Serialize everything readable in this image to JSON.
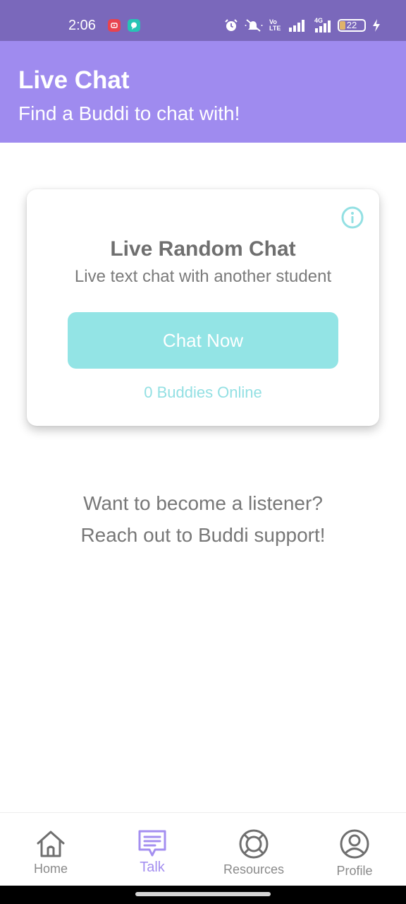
{
  "status_bar": {
    "time": "2:06",
    "network_label": "4G",
    "volte_label": "Vo LTE",
    "battery_level": "22",
    "icons": [
      "youtube-app-icon",
      "chat-app-icon",
      "alarm-icon",
      "mute-icon",
      "volte-icon",
      "signal-icon",
      "signal-4g-icon",
      "battery-icon",
      "charging-icon"
    ]
  },
  "header": {
    "title": "Live Chat",
    "subtitle": "Find a Buddi to chat with!"
  },
  "card": {
    "title": "Live Random Chat",
    "subtitle": "Live text chat with another student",
    "button_label": "Chat Now",
    "online_count_text": "0 Buddies Online",
    "info_icon": "info-icon"
  },
  "listener_promo": {
    "line1": "Want to become a listener?",
    "line2": "Reach out to Buddi support!"
  },
  "bottom_nav": {
    "items": [
      {
        "label": "Home",
        "icon": "home-icon",
        "active": false
      },
      {
        "label": "Talk",
        "icon": "chat-bubble-icon",
        "active": true
      },
      {
        "label": "Resources",
        "icon": "lifebuoy-icon",
        "active": false
      },
      {
        "label": "Profile",
        "icon": "user-circle-icon",
        "active": false
      }
    ]
  },
  "colors": {
    "status_bar": "#7a68bb",
    "header": "#9f8bef",
    "accent_teal": "#93e4e5",
    "active_nav": "#a48ff0",
    "text_gray": "#777777"
  }
}
